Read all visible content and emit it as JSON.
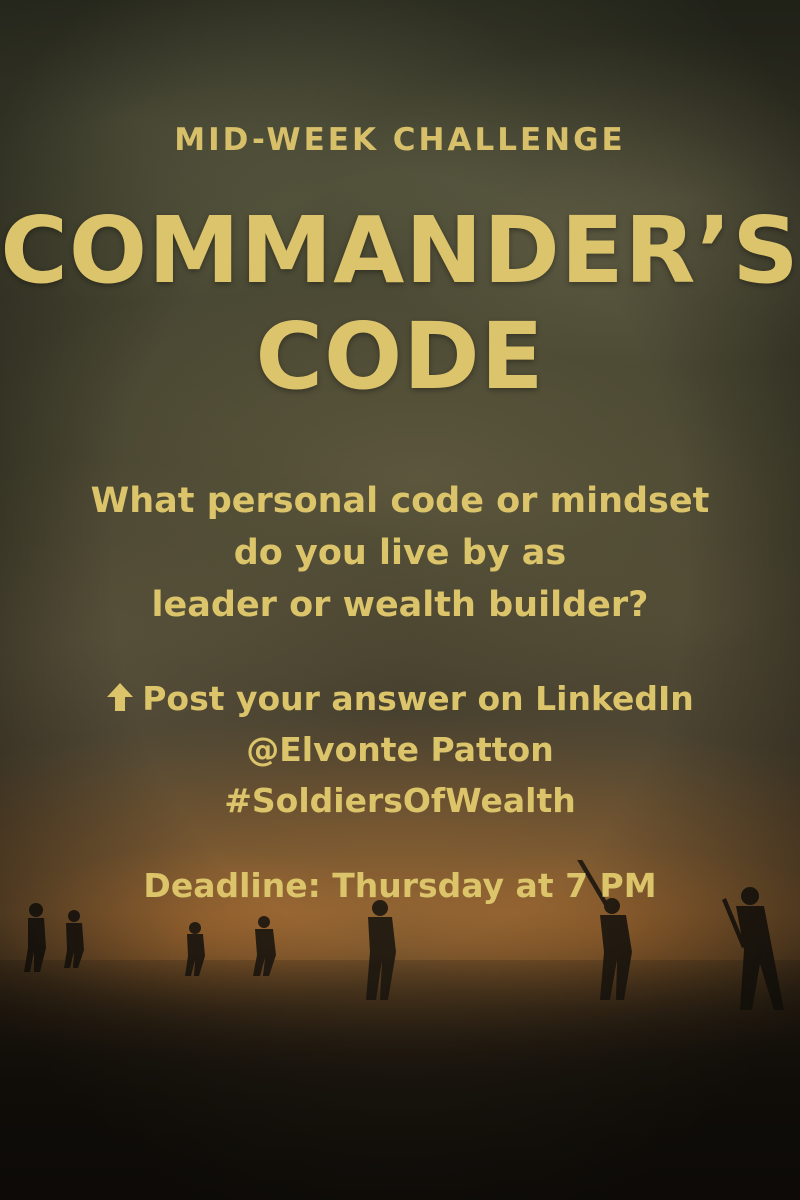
{
  "poster": {
    "eyebrow": "MID-WEEK CHALLENGE",
    "title_line1": "COMMANDER’S",
    "title_line2": "CODE",
    "question_line1": "What personal code or mindset",
    "question_line2": "do you live by as",
    "question_line3": "leader or wealth builder?",
    "cta_line1": "Post your answer on LinkedIn",
    "cta_line2": "@Elvonte Patton",
    "cta_line3": "#SoldiersOfWealth",
    "deadline": "Deadline: Thursday at 7 PM",
    "cta_icon": "up-arrow-icon"
  },
  "colors": {
    "text_gold": "#dcc46a",
    "sky_dark": "#3b3d2c",
    "fire_glow": "#b8742f",
    "ground": "#17130d"
  }
}
